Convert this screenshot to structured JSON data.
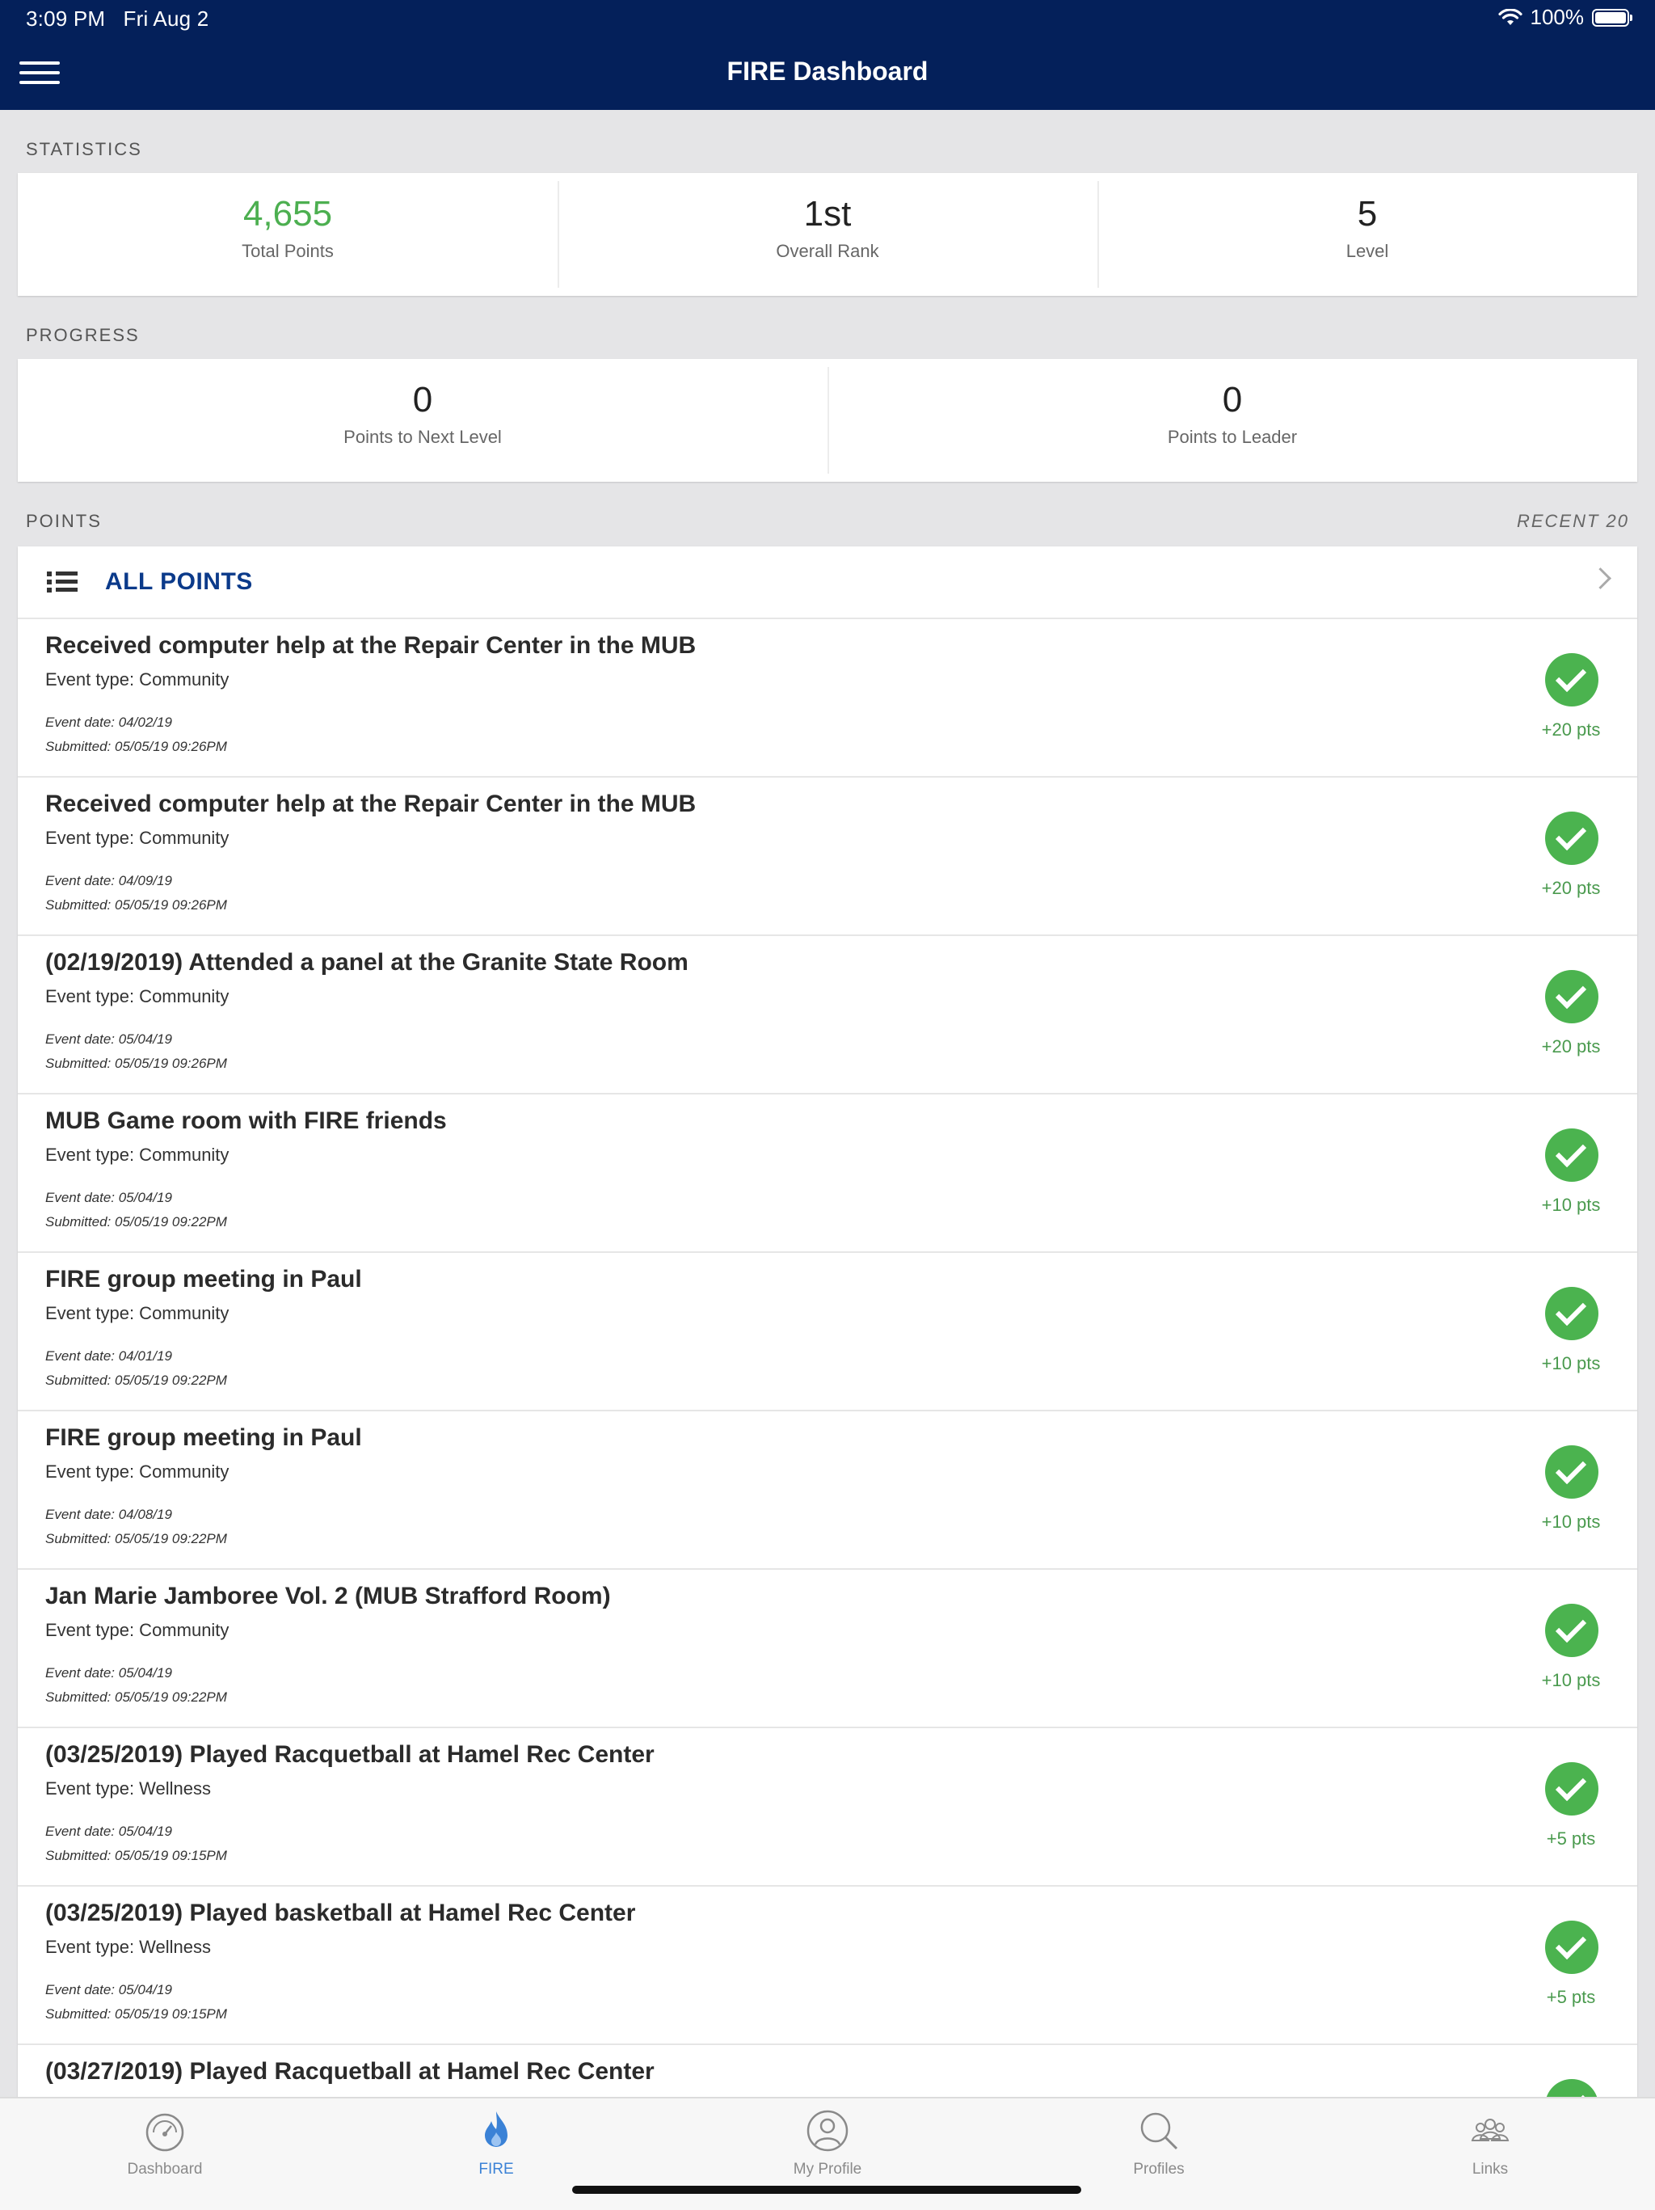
{
  "status_bar": {
    "time": "3:09 PM",
    "date": "Fri Aug 2",
    "battery": "100%"
  },
  "nav": {
    "title": "FIRE Dashboard"
  },
  "statistics": {
    "label": "STATISTICS",
    "items": [
      {
        "value": "4,655",
        "label": "Total Points"
      },
      {
        "value": "1st",
        "label": "Overall Rank"
      },
      {
        "value": "5",
        "label": "Level"
      }
    ]
  },
  "progress": {
    "label": "PROGRESS",
    "items": [
      {
        "value": "0",
        "label": "Points to Next Level"
      },
      {
        "value": "0",
        "label": "Points to Leader"
      }
    ]
  },
  "points": {
    "label": "POINTS",
    "recent_label": "RECENT 20",
    "all_label": "ALL POINTS",
    "entries": [
      {
        "title": "Received computer help at the Repair Center in the MUB",
        "type": "Event type: Community",
        "event_date": "Event date: 04/02/19",
        "submitted": "Submitted: 05/05/19 09:26PM",
        "points": "+20 pts"
      },
      {
        "title": "Received computer help at the Repair Center in the MUB",
        "type": "Event type: Community",
        "event_date": "Event date: 04/09/19",
        "submitted": "Submitted: 05/05/19 09:26PM",
        "points": "+20 pts"
      },
      {
        "title": "(02/19/2019) Attended a panel at the Granite State Room",
        "type": "Event type: Community",
        "event_date": "Event date: 05/04/19",
        "submitted": "Submitted: 05/05/19 09:26PM",
        "points": "+20 pts"
      },
      {
        "title": "MUB Game room with FIRE friends",
        "type": "Event type: Community",
        "event_date": "Event date: 05/04/19",
        "submitted": "Submitted: 05/05/19 09:22PM",
        "points": "+10 pts"
      },
      {
        "title": "FIRE group meeting in Paul",
        "type": "Event type: Community",
        "event_date": "Event date: 04/01/19",
        "submitted": "Submitted: 05/05/19 09:22PM",
        "points": "+10 pts"
      },
      {
        "title": "FIRE group meeting in Paul",
        "type": "Event type: Community",
        "event_date": "Event date: 04/08/19",
        "submitted": "Submitted: 05/05/19 09:22PM",
        "points": "+10 pts"
      },
      {
        "title": "Jan Marie Jamboree Vol. 2 (MUB Strafford Room)",
        "type": "Event type: Community",
        "event_date": "Event date: 05/04/19",
        "submitted": "Submitted: 05/05/19 09:22PM",
        "points": "+10 pts"
      },
      {
        "title": "(03/25/2019) Played Racquetball at Hamel Rec Center",
        "type": "Event type: Wellness",
        "event_date": "Event date: 05/04/19",
        "submitted": "Submitted: 05/05/19 09:15PM",
        "points": "+5 pts"
      },
      {
        "title": "(03/25/2019) Played basketball at Hamel Rec Center",
        "type": "Event type: Wellness",
        "event_date": "Event date: 05/04/19",
        "submitted": "Submitted: 05/05/19 09:15PM",
        "points": "+5 pts"
      },
      {
        "title": "(03/27/2019) Played Racquetball at Hamel Rec Center",
        "type": "",
        "event_date": "",
        "submitted": "",
        "points": ""
      }
    ]
  },
  "tabbar": {
    "items": [
      {
        "label": "Dashboard",
        "icon": "dashboard-icon"
      },
      {
        "label": "FIRE",
        "icon": "flame-icon"
      },
      {
        "label": "My Profile",
        "icon": "profile-icon"
      },
      {
        "label": "Profiles",
        "icon": "search-icon"
      },
      {
        "label": "Links",
        "icon": "group-icon"
      }
    ],
    "active": "FIRE"
  },
  "colors": {
    "nav_bg": "#04205a",
    "accent_green": "#4bb34f",
    "link_blue": "#0b3a8a",
    "tab_active": "#3b82d6"
  }
}
